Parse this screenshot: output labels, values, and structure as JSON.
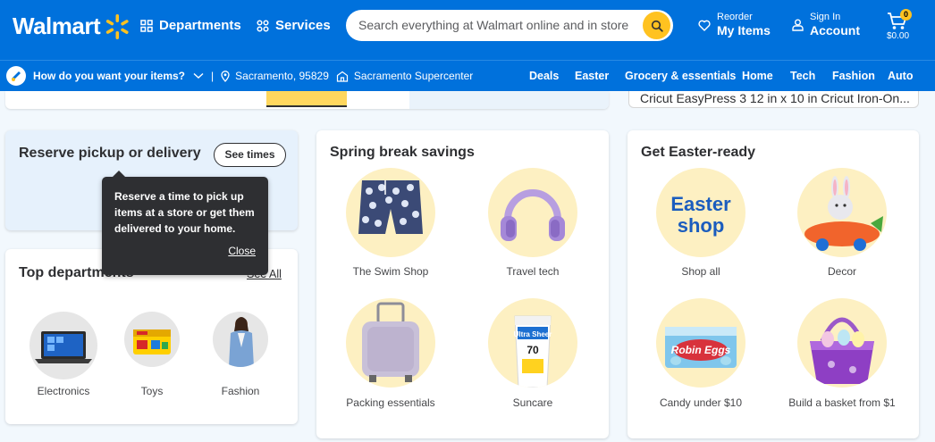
{
  "header": {
    "logo_text": "Walmart",
    "departments_label": "Departments",
    "services_label": "Services",
    "search_placeholder": "Search everything at Walmart online and in store",
    "reorder_small": "Reorder",
    "reorder_big": "My Items",
    "signin_small": "Sign In",
    "signin_big": "Account",
    "cart_count": "0",
    "cart_total": "$0.00"
  },
  "subbar": {
    "question": "How do you want your items?",
    "separator": "|",
    "location": "Sacramento, 95829",
    "store": "Sacramento Supercenter",
    "links": [
      "Deals",
      "Easter",
      "Grocery & essentials",
      "Home",
      "Tech",
      "Fashion",
      "Auto"
    ]
  },
  "promo_strip": {
    "item_text": "Cricut EasyPress 3 12 in x 10 in Cricut Iron-On..."
  },
  "reserve": {
    "title": "Reserve pickup or delivery",
    "button": "See times",
    "tooltip_text": "Reserve a time to pick up items at a store or get them delivered to your home.",
    "tooltip_close": "Close"
  },
  "top_departments": {
    "title": "Top departments",
    "see_all": "See All",
    "items": [
      "Electronics",
      "Toys",
      "Fashion"
    ]
  },
  "spring_break": {
    "title": "Spring break savings",
    "items": [
      "The Swim Shop",
      "Travel tech",
      "Packing essentials",
      "Suncare"
    ]
  },
  "easter": {
    "title": "Get Easter-ready",
    "items": [
      "Shop all",
      "Decor",
      "Candy under $10",
      "Build a basket from $1"
    ],
    "shop_all_art": "Easter shop",
    "candy_art": "Robin Eggs",
    "suncare_art": "Ultra Sheer 70"
  },
  "colors": {
    "brand_blue": "#0071dc",
    "spark_yellow": "#ffc220",
    "tooltip_bg": "#2e2f32",
    "circle_yellow": "#fdf0c2"
  }
}
